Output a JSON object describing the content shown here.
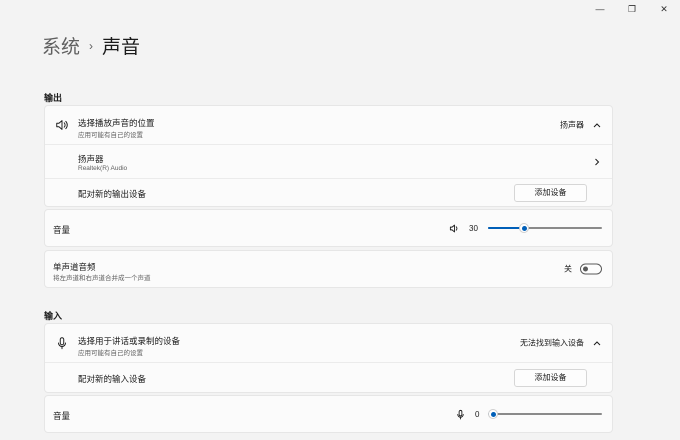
{
  "window": {
    "minimize_glyph": "—",
    "maximize_glyph": "❐",
    "close_glyph": "✕"
  },
  "breadcrumb": {
    "parent": "系统",
    "separator": "›",
    "current": "声音"
  },
  "output": {
    "section_label": "输出",
    "choose_device": {
      "icon": "speaker-icon",
      "title": "选择播放声音的位置",
      "subtitle": "应用可能有自己的设置",
      "selected": "扬声器"
    },
    "device": {
      "name": "扬声器",
      "driver": "Realtek(R) Audio"
    },
    "pair": {
      "label": "配对新的输出设备",
      "button": "添加设备"
    },
    "volume": {
      "label": "音量",
      "icon": "speaker-volume-icon",
      "value": "30",
      "level": 30
    },
    "mono": {
      "title": "单声道音频",
      "subtitle": "将左声道和右声道合并成一个声道",
      "state": "关",
      "on": false
    }
  },
  "input": {
    "section_label": "输入",
    "choose_device": {
      "icon": "microphone-icon",
      "title": "选择用于讲话或录制的设备",
      "subtitle": "应用可能有自己的设置",
      "selected": "无法找到输入设备"
    },
    "pair": {
      "label": "配对新的输入设备",
      "button": "添加设备"
    },
    "volume": {
      "label": "音量",
      "icon": "microphone-volume-icon",
      "value": "0",
      "level": 0
    }
  },
  "colors": {
    "accent": "#005fb8",
    "background": "#f3f3f3",
    "card": "#fbfbfb"
  }
}
